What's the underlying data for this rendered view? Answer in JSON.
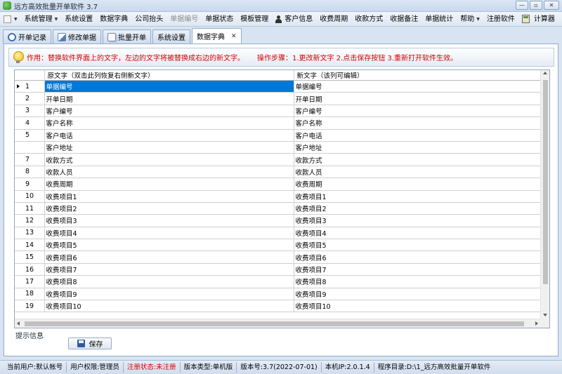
{
  "window": {
    "title": "远方高效批量开单软件 3.7",
    "buttons": {
      "minimize": "—",
      "restore": "▫",
      "close": "✕"
    }
  },
  "menu": [
    {
      "label": "系统管理",
      "dropdown": true,
      "disabled": false
    },
    {
      "label": "系统设置",
      "disabled": false
    },
    {
      "label": "数据字典",
      "disabled": false
    },
    {
      "label": "公司抬头",
      "disabled": false
    },
    {
      "label": "单据编号",
      "disabled": true
    },
    {
      "label": "单据状态",
      "disabled": false
    },
    {
      "label": "模板管理",
      "disabled": false
    },
    {
      "label": "客户信息",
      "icon": "person-icon",
      "disabled": false
    },
    {
      "label": "收费周期",
      "disabled": false
    },
    {
      "label": "收款方式",
      "disabled": false
    },
    {
      "label": "收据备注",
      "disabled": false
    },
    {
      "label": "单据统计",
      "disabled": false
    },
    {
      "label": "帮助",
      "dropdown": true,
      "disabled": false
    },
    {
      "label": "注册软件",
      "disabled": false
    },
    {
      "label": "计算器",
      "icon": "calculator-icon",
      "disabled": false
    }
  ],
  "tabs": [
    {
      "label": "开单记录",
      "icon": "clock-icon",
      "active": false
    },
    {
      "label": "修改单据",
      "icon": "edit-icon",
      "active": false
    },
    {
      "label": "批量开单",
      "icon": "batch-icon",
      "active": false
    },
    {
      "label": "系统设置",
      "active": false
    },
    {
      "label": "数据字典",
      "active": true,
      "closable": true
    }
  ],
  "notice": {
    "usage": "作用：替换软件界面上的文字，左边的文字将被替换成右边的新文字。",
    "steps": "操作步骤：1.更改新文字  2.点击保存按钮  3.重新打开软件生效。"
  },
  "grid": {
    "columns": [
      "",
      "原文字（双击此列恢复右侧新文字）",
      "新文字（该列可编辑）"
    ],
    "selected_row": 0,
    "rows": [
      {
        "num": "1",
        "orig": "单据编号",
        "new": "单据编号"
      },
      {
        "num": "2",
        "orig": "开单日期",
        "new": "开单日期"
      },
      {
        "num": "3",
        "orig": "客户编号",
        "new": "客户编号"
      },
      {
        "num": "4",
        "orig": "客户名称",
        "new": "客户名称"
      },
      {
        "num": "5",
        "orig": "客户电话",
        "new": "客户电话"
      },
      {
        "num": "",
        "orig": "客户地址",
        "new": "客户地址"
      },
      {
        "num": "7",
        "orig": "收款方式",
        "new": "收款方式"
      },
      {
        "num": "8",
        "orig": "收款人员",
        "new": "收款人员"
      },
      {
        "num": "9",
        "orig": "收费周期",
        "new": "收费周期"
      },
      {
        "num": "10",
        "orig": "收费项目1",
        "new": "收费项目1"
      },
      {
        "num": "11",
        "orig": "收费项目2",
        "new": "收费项目2"
      },
      {
        "num": "12",
        "orig": "收费项目3",
        "new": "收费项目3"
      },
      {
        "num": "13",
        "orig": "收费项目4",
        "new": "收费项目4"
      },
      {
        "num": "14",
        "orig": "收费项目5",
        "new": "收费项目5"
      },
      {
        "num": "15",
        "orig": "收费项目6",
        "new": "收费项目6"
      },
      {
        "num": "16",
        "orig": "收费项目7",
        "new": "收费项目7"
      },
      {
        "num": "17",
        "orig": "收费项目8",
        "new": "收费项目8"
      },
      {
        "num": "18",
        "orig": "收费项目9",
        "new": "收费项目9"
      },
      {
        "num": "19",
        "orig": "收费项目10",
        "new": "收费项目10"
      }
    ]
  },
  "hint_label": "提示信息",
  "save_button": "保存",
  "status": [
    {
      "text": "当前用户:默认帐号",
      "highlight": false
    },
    {
      "text": "用户权限:管理员",
      "highlight": false
    },
    {
      "text": "注册状态:未注册",
      "highlight": true
    },
    {
      "text": "版本类型:单机版",
      "highlight": false
    },
    {
      "text": "版本号:3.7(2022-07-01)",
      "highlight": false
    },
    {
      "text": "本机IP:2.0.1.4",
      "highlight": false
    },
    {
      "text": "程序目录:D:\\1_远方高效批量开单软件",
      "highlight": false
    }
  ],
  "colors": {
    "selection": "#0078d7",
    "warning_text": "#d40000",
    "chrome": "#d8e4f2"
  }
}
